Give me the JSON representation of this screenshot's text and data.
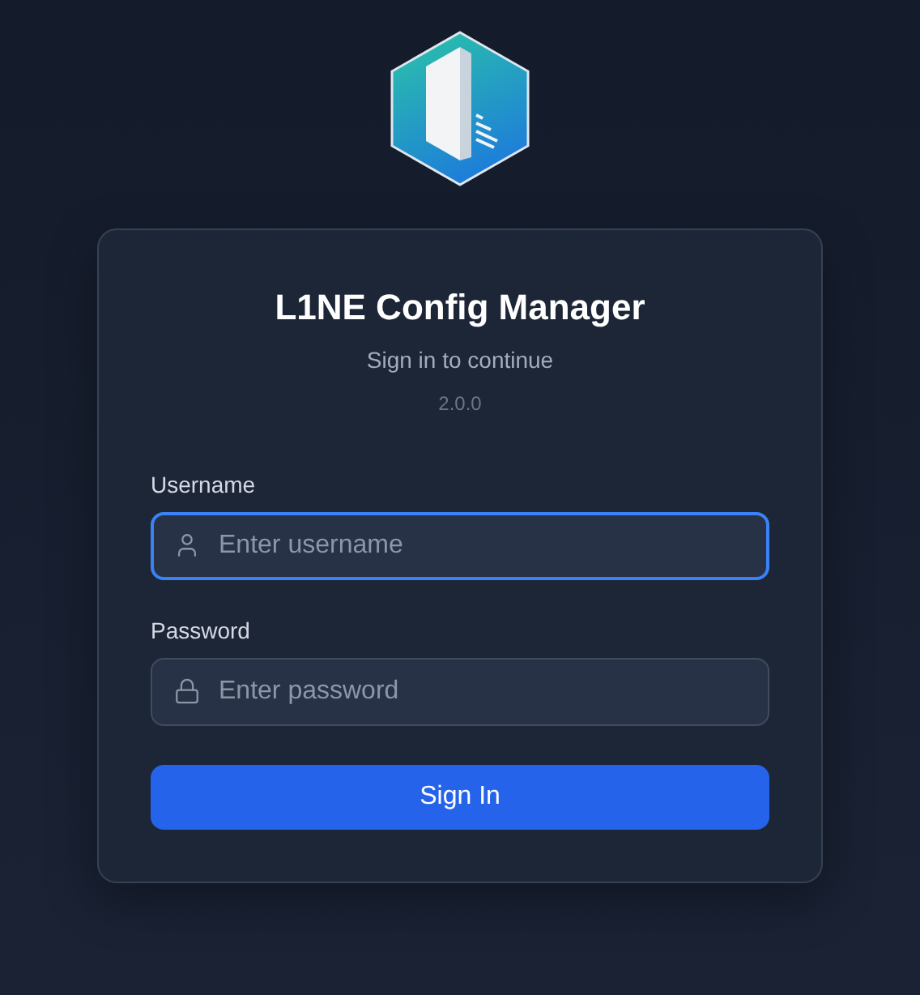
{
  "app": {
    "title": "L1NE Config Manager",
    "subtitle": "Sign in to continue",
    "version": "2.0.0"
  },
  "fields": [
    {
      "kind": "username",
      "label": "Username",
      "placeholder": "Enter username",
      "focused": true
    },
    {
      "kind": "password",
      "label": "Password",
      "placeholder": "Enter password",
      "focused": false
    }
  ],
  "submit": {
    "label": "Sign In"
  }
}
